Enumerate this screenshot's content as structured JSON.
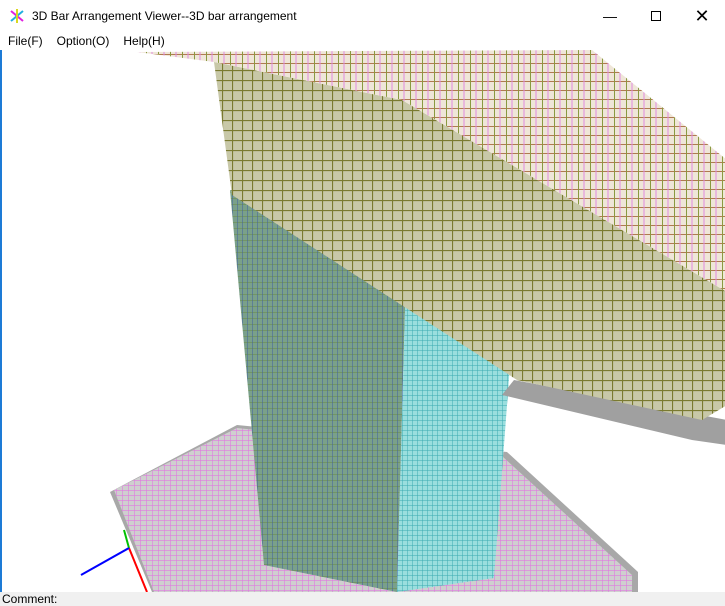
{
  "window": {
    "title": "3D Bar Arrangement Viewer--3D bar arrangement",
    "minimize_icon": "minimize-icon",
    "maximize_icon": "maximize-icon",
    "close_icon": "close-icon"
  },
  "menu": [
    {
      "label": "File(F)"
    },
    {
      "label": "Option(O)"
    },
    {
      "label": "Help(H)"
    }
  ],
  "status": {
    "comment_label": "Comment:"
  },
  "colors": {
    "slab": "#d98ad8",
    "column": "#5fc4c4",
    "beam": "#8a8a3a",
    "axis_x": "#ff0000",
    "axis_y": "#00c000",
    "axis_z": "#0000ff"
  }
}
